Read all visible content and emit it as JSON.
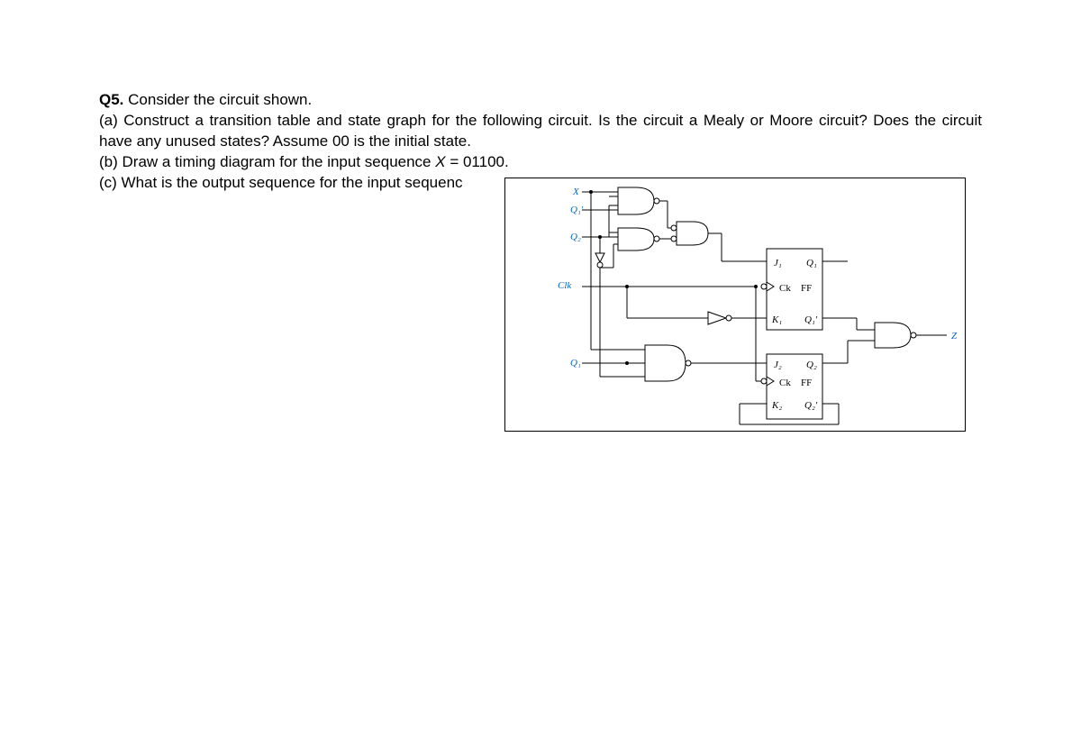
{
  "question": {
    "number": "Q5.",
    "intro": "Consider the circuit shown.",
    "part_a": "(a) Construct a transition table and state graph for the following circuit. Is the circuit a Mealy or Moore circuit? Does the circuit have any unused states? Assume 00 is the initial state.",
    "part_b_prefix": "(b) Draw a timing diagram for the input sequence ",
    "part_b_var": "X",
    "part_b_suffix": " =  01100.",
    "part_c": "(c) What is the output sequence for the input sequenc"
  },
  "diagram": {
    "labels": {
      "X": "X",
      "Q1prime": "Q₁′",
      "Q2": "Q₂",
      "Clk": "Clk",
      "Q1": "Q₁",
      "J1": "J₁",
      "Q1_out": "Q₁",
      "Ck1": "Ck",
      "FF1": "FF",
      "K1": "K₁",
      "Q1prime_out": "Q₁′",
      "J2": "J₂",
      "Q2_out": "Q₂",
      "Ck2": "Ck",
      "FF2": "FF",
      "K2": "K₂",
      "Q2prime_out": "Q₂′",
      "Z": "Z"
    }
  }
}
